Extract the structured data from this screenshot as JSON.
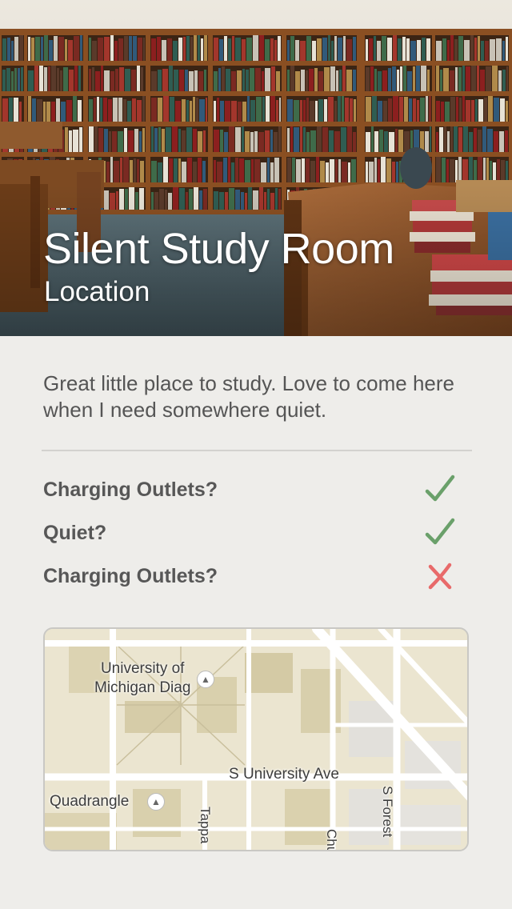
{
  "place": {
    "title": "Silent Study Room",
    "subtitle": "Location",
    "description": "Great little place to study. Love to come here when I need somewhere quiet."
  },
  "features": [
    {
      "label": "Charging Outlets?",
      "status": "yes",
      "icon": "check-icon"
    },
    {
      "label": "Quiet?",
      "status": "yes",
      "icon": "check-icon"
    },
    {
      "label": "Charging Outlets?",
      "status": "no",
      "icon": "cross-icon"
    }
  ],
  "colors": {
    "background": "#eeedea",
    "check": "#6aa06a",
    "cross": "#e86a6a",
    "text": "#575757"
  },
  "map": {
    "labels": {
      "diag_line1": "University of",
      "diag_line2": "Michigan Diag",
      "street_s_university": "S University Ave",
      "quadrangle": "Quadrangle",
      "tappan": "Tappa",
      "church": "Chu",
      "forest": "S Forest"
    }
  }
}
